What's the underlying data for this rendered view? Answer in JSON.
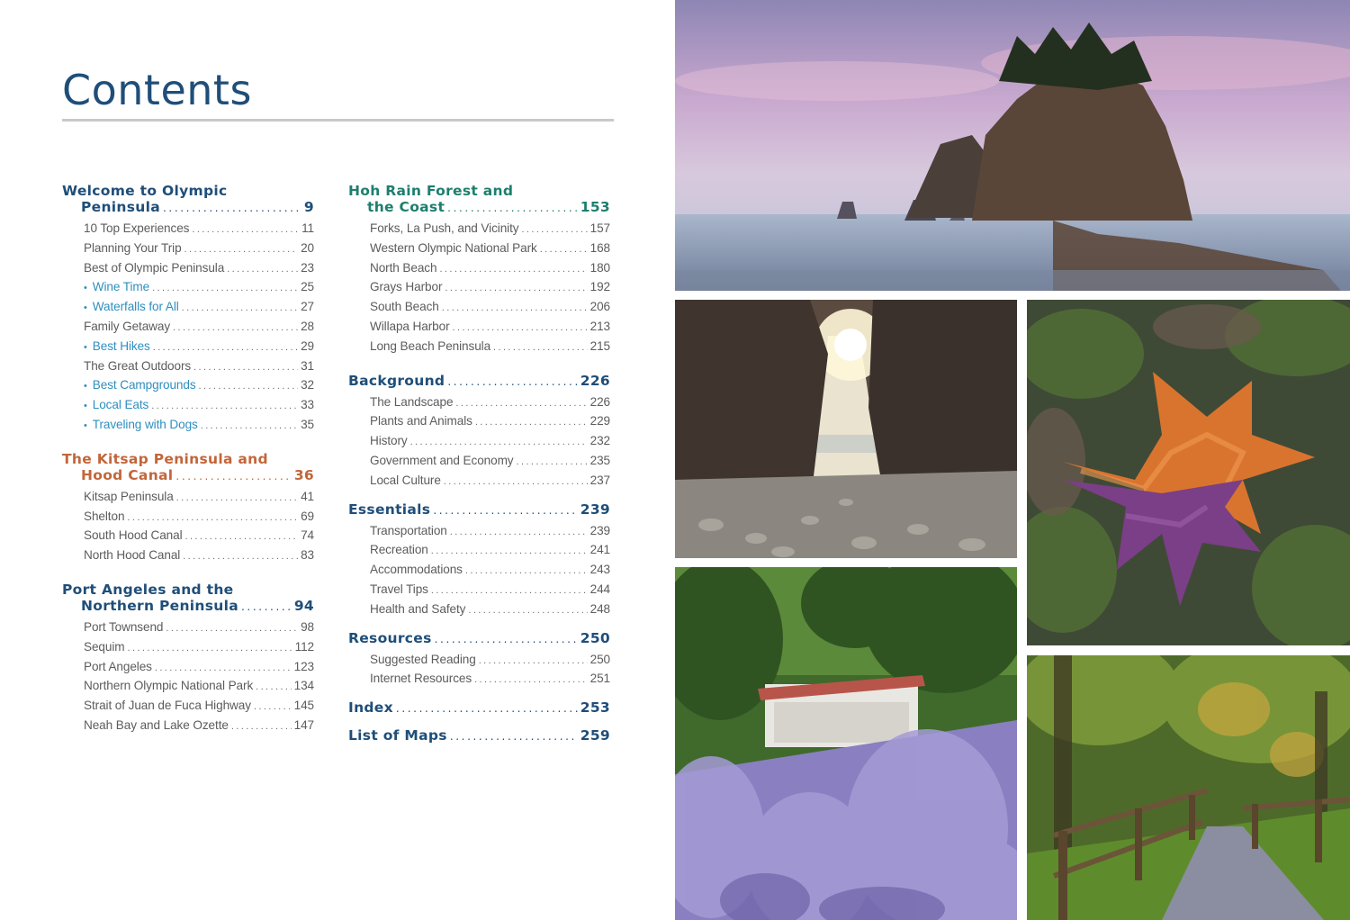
{
  "title": "Contents",
  "colors": {
    "navy": "#1f4e79",
    "rust": "#c2663a",
    "teal": "#1e7e6e",
    "bullet_blue": "#2e8fbf",
    "rule_gray": "#c9c9c9"
  },
  "left_column": [
    {
      "title_line1": "Welcome to Olympic",
      "title_line2": "Peninsula",
      "page": "9",
      "color": "navy",
      "items": [
        {
          "label": "10 Top Experiences",
          "page": "11",
          "bullet": false
        },
        {
          "label": "Planning Your Trip",
          "page": "20",
          "bullet": false
        },
        {
          "label": "Best of Olympic Peninsula",
          "page": "23",
          "bullet": false
        },
        {
          "label": "Wine Time",
          "page": "25",
          "bullet": true
        },
        {
          "label": "Waterfalls for All",
          "page": "27",
          "bullet": true
        },
        {
          "label": "Family Getaway",
          "page": "28",
          "bullet": false
        },
        {
          "label": "Best Hikes",
          "page": "29",
          "bullet": true
        },
        {
          "label": "The Great Outdoors",
          "page": "31",
          "bullet": false
        },
        {
          "label": "Best Campgrounds",
          "page": "32",
          "bullet": true
        },
        {
          "label": "Local Eats",
          "page": "33",
          "bullet": true
        },
        {
          "label": "Traveling with Dogs",
          "page": "35",
          "bullet": true
        }
      ]
    },
    {
      "title_line1": "The Kitsap Peninsula and",
      "title_line2": "Hood Canal",
      "page": "36",
      "color": "rust",
      "items": [
        {
          "label": "Kitsap Peninsula",
          "page": "41",
          "bullet": false
        },
        {
          "label": "Shelton",
          "page": "69",
          "bullet": false
        },
        {
          "label": "South Hood Canal",
          "page": "74",
          "bullet": false
        },
        {
          "label": "North Hood Canal",
          "page": "83",
          "bullet": false
        }
      ]
    },
    {
      "title_line1": "Port Angeles and the",
      "title_line2": "Northern Peninsula",
      "page": "94",
      "color": "navy",
      "items": [
        {
          "label": "Port Townsend",
          "page": "98",
          "bullet": false
        },
        {
          "label": "Sequim",
          "page": "112",
          "bullet": false
        },
        {
          "label": "Port Angeles",
          "page": "123",
          "bullet": false
        },
        {
          "label": "Northern Olympic National Park",
          "page": "134",
          "bullet": false
        },
        {
          "label": "Strait of Juan de Fuca Highway",
          "page": "145",
          "bullet": false
        },
        {
          "label": "Neah Bay and Lake Ozette",
          "page": "147",
          "bullet": false
        }
      ]
    }
  ],
  "right_column": [
    {
      "title_line1": "Hoh Rain Forest and",
      "title_line2": "the Coast",
      "page": "153",
      "color": "teal",
      "items": [
        {
          "label": "Forks, La Push, and Vicinity",
          "page": "157",
          "bullet": false
        },
        {
          "label": "Western Olympic National Park",
          "page": "168",
          "bullet": false
        },
        {
          "label": "North Beach",
          "page": "180",
          "bullet": false
        },
        {
          "label": "Grays Harbor",
          "page": "192",
          "bullet": false
        },
        {
          "label": "South Beach",
          "page": "206",
          "bullet": false
        },
        {
          "label": "Willapa Harbor",
          "page": "213",
          "bullet": false
        },
        {
          "label": "Long Beach Peninsula",
          "page": "215",
          "bullet": false
        }
      ]
    },
    {
      "title_line1": "",
      "title_line2": "Background",
      "page": "226",
      "color": "navy",
      "items": [
        {
          "label": "The Landscape",
          "page": "226",
          "bullet": false
        },
        {
          "label": "Plants and Animals",
          "page": "229",
          "bullet": false
        },
        {
          "label": "History",
          "page": "232",
          "bullet": false
        },
        {
          "label": "Government and Economy",
          "page": "235",
          "bullet": false
        },
        {
          "label": "Local Culture",
          "page": "237",
          "bullet": false
        }
      ]
    },
    {
      "title_line1": "",
      "title_line2": "Essentials",
      "page": "239",
      "color": "navy",
      "items": [
        {
          "label": "Transportation",
          "page": "239",
          "bullet": false
        },
        {
          "label": "Recreation",
          "page": "241",
          "bullet": false
        },
        {
          "label": "Accommodations",
          "page": "243",
          "bullet": false
        },
        {
          "label": "Travel Tips",
          "page": "244",
          "bullet": false
        },
        {
          "label": "Health and Safety",
          "page": "248",
          "bullet": false
        }
      ]
    },
    {
      "title_line1": "",
      "title_line2": "Resources",
      "page": "250",
      "color": "navy",
      "items": [
        {
          "label": "Suggested Reading",
          "page": "250",
          "bullet": false
        },
        {
          "label": "Internet Resources",
          "page": "251",
          "bullet": false
        }
      ]
    },
    {
      "title_line1": "",
      "title_line2": "Index",
      "page": "253",
      "color": "navy",
      "items": []
    },
    {
      "title_line1": "",
      "title_line2": "List of Maps",
      "page": "259",
      "color": "navy",
      "items": []
    }
  ]
}
